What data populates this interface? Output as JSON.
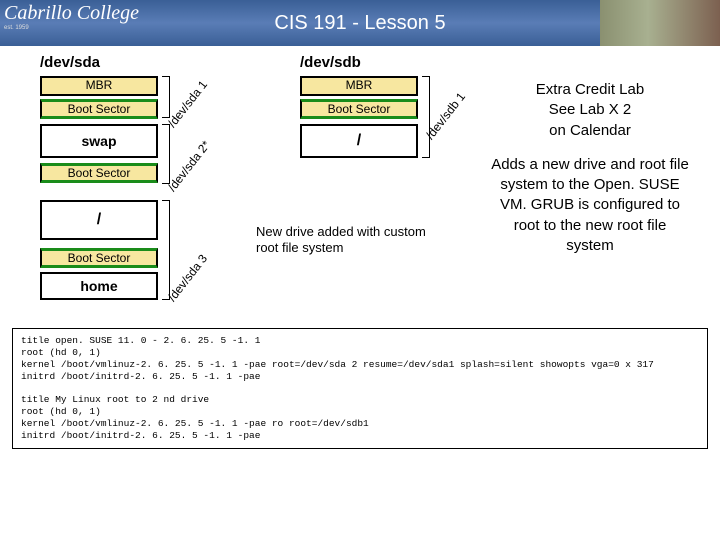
{
  "header": {
    "logo_text": "Cabrillo College",
    "logo_sub": "est. 1959",
    "title": "CIS 191 - Lesson 5"
  },
  "labels": {
    "dev_sda": "/dev/sda",
    "dev_sdb": "/dev/sdb",
    "mbr": "MBR",
    "boot_sector": "Boot Sector",
    "swap": "swap",
    "root": "/",
    "home": "home"
  },
  "devpaths": {
    "sda1": "/dev/sda 1",
    "sda2": "/dev/sda 2*",
    "sda3": "/dev/sda 3",
    "sdb1": "/dev/sdb 1"
  },
  "note": "New drive added with custom root file system",
  "side": {
    "extra_credit": "Extra Credit Lab\nSee Lab X 2\non Calendar",
    "desc": "Adds a new drive and root file system to the Open. SUSE VM. GRUB is configured to root to the new root file system"
  },
  "grub": "title open. SUSE 11. 0 - 2. 6. 25. 5 -1. 1\nroot (hd 0, 1)\nkernel /boot/vmlinuz-2. 6. 25. 5 -1. 1 -pae root=/dev/sda 2 resume=/dev/sda1 splash=silent showopts vga=0 x 317\ninitrd /boot/initrd-2. 6. 25. 5 -1. 1 -pae\n\ntitle My Linux root to 2 nd drive\nroot (hd 0, 1)\nkernel /boot/vmlinuz-2. 6. 25. 5 -1. 1 -pae ro root=/dev/sdb1\ninitrd /boot/initrd-2. 6. 25. 5 -1. 1 -pae"
}
